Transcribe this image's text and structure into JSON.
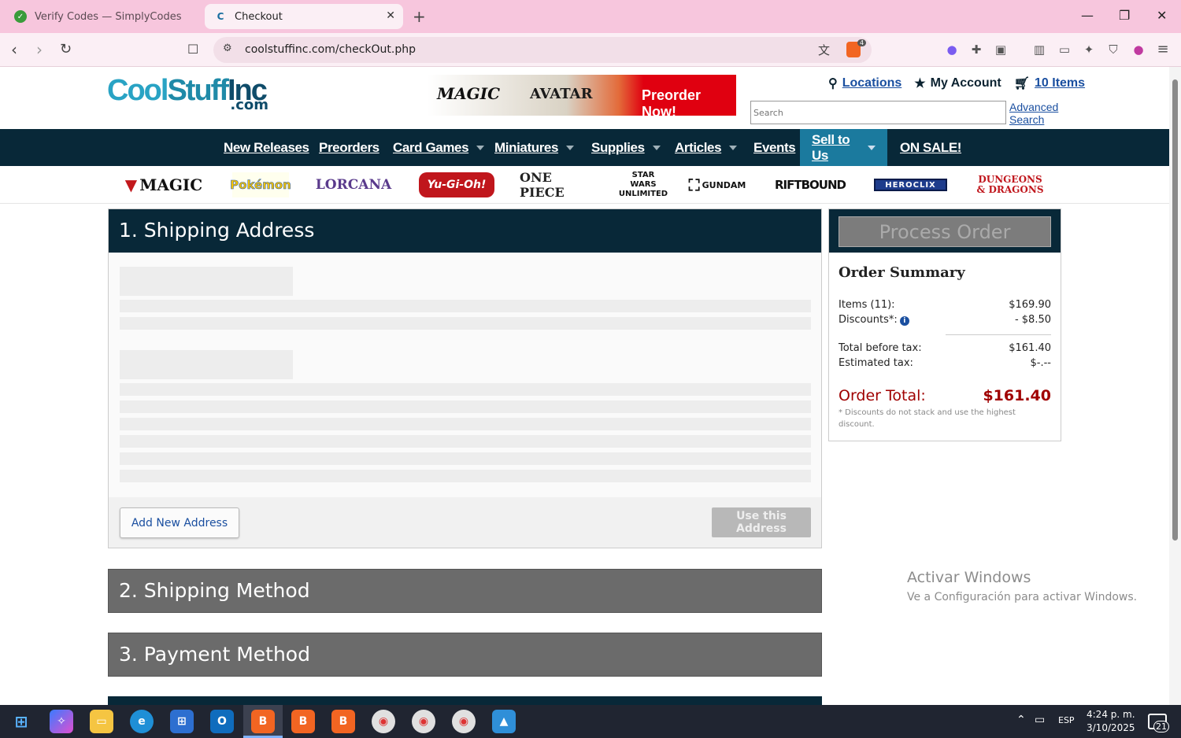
{
  "browser": {
    "tabs": [
      {
        "title": "Verify Codes — SimplyCodes",
        "active": false
      },
      {
        "title": "Checkout",
        "active": true
      }
    ],
    "url": "coolstuffinc.com/checkOut.php",
    "brave_badge": "4"
  },
  "header": {
    "logo_cool": "Cool",
    "logo_stuff": "Stuff",
    "logo_inc": "Inc",
    "logo_com": ".com",
    "banner": {
      "left": "MAGIC",
      "middle": "AVATAR",
      "cta": "Preorder Now!"
    },
    "links": {
      "locations": "Locations",
      "account": "My Account",
      "cart": "10 Items"
    },
    "search_placeholder": "Search",
    "advanced_search": "Advanced Search"
  },
  "nav": {
    "items": [
      "New Releases",
      "Preorders",
      "Card Games",
      "Miniatures",
      "Supplies",
      "Articles",
      "Events",
      "Sell to Us",
      "ON SALE!"
    ]
  },
  "brands": [
    "MAGIC",
    "Pokémon",
    "LORCANA",
    "Yu-Gi-Oh!",
    "ONE PIECE",
    "STAR WARS UNLIMITED",
    "GUNDAM",
    "RIFTBOUND",
    "HEROCLIX",
    "DUNGEONS & DRAGONS"
  ],
  "checkout": {
    "step1": "1. Shipping Address",
    "step2": "2. Shipping Method",
    "step3": "3. Payment Method",
    "add_address": "Add New Address",
    "use_address": "Use this Address"
  },
  "summary": {
    "process": "Process Order",
    "title": "Order Summary",
    "items_label": "Items (11):",
    "items_value": "$169.90",
    "discounts_label": "Discounts*:",
    "discounts_value": "- $8.50",
    "before_tax_label": "Total before tax:",
    "before_tax_value": "$161.40",
    "tax_label": "Estimated tax:",
    "tax_value": "$-.--",
    "total_label": "Order Total:",
    "total_value": "$161.40",
    "note": "* Discounts do not stack and use the highest discount."
  },
  "watermark": {
    "line1": "Activar Windows",
    "line2": "Ve a Configuración para activar Windows."
  },
  "taskbar": {
    "lang": "ESP",
    "time": "4:24 p. m.",
    "date": "3/10/2025",
    "notifications": "21"
  },
  "colors": {
    "nav_bg": "#082838",
    "sell_bg": "#1b7a9e",
    "total_red": "#a00000",
    "tab_bar": "#f7c6dd"
  }
}
